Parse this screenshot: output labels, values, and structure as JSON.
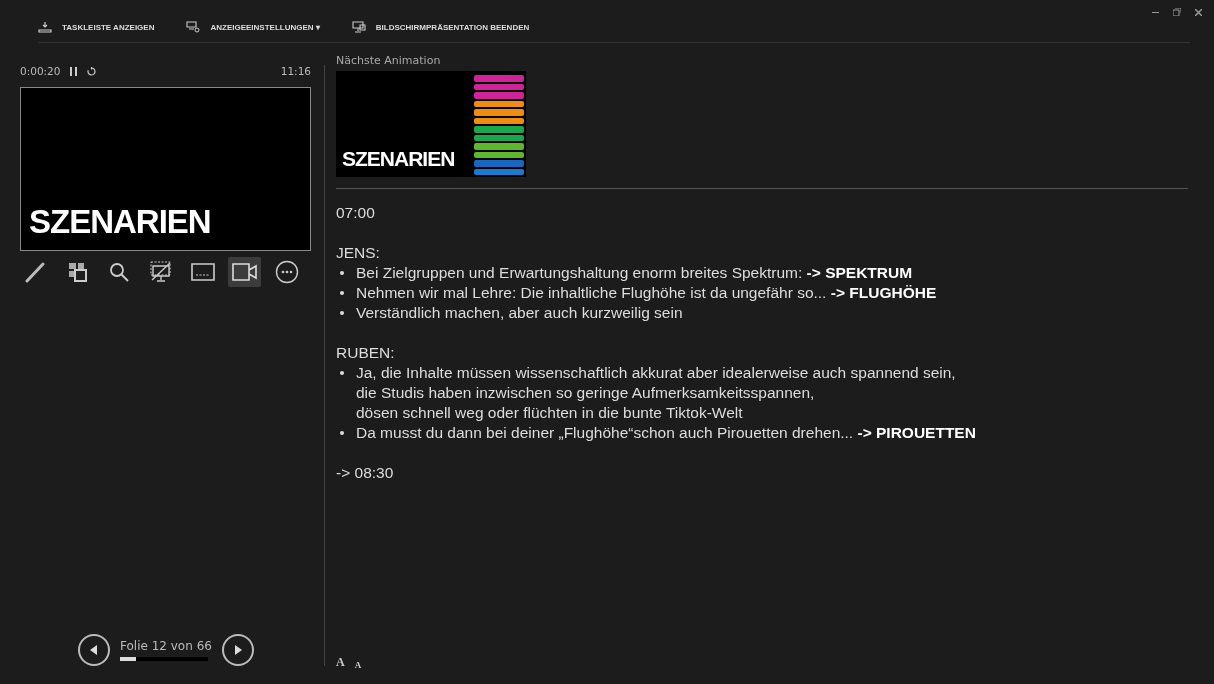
{
  "toolbar": [
    {
      "kind": "taskbar",
      "label": "TASKLEISTE ANZEIGEN"
    },
    {
      "kind": "display",
      "label": "ANZEIGEEINSTELLUNGEN ▾"
    },
    {
      "kind": "end",
      "label": "BILDSCHIRMPRÄSENTATION BEENDEN"
    }
  ],
  "timer": {
    "elapsed": "0:00:20",
    "paused": true,
    "clock": "11:16"
  },
  "current_slide": {
    "title": "SZENARIEN"
  },
  "tools": [
    {
      "kind": "pen",
      "selected": false
    },
    {
      "kind": "slides",
      "selected": false
    },
    {
      "kind": "zoom",
      "selected": false
    },
    {
      "kind": "black",
      "selected": false
    },
    {
      "kind": "subtitles",
      "selected": false
    },
    {
      "kind": "camera",
      "selected": true
    },
    {
      "kind": "more",
      "selected": false
    }
  ],
  "navigation": {
    "label": "Folie 12 von 66",
    "level": 0.18
  },
  "next": {
    "label": "Nächste Animation",
    "title": "SZENARIEN",
    "bars": [
      {
        "color": "#d0239a"
      },
      {
        "color": "#d0239a"
      },
      {
        "color": "#d0239a"
      },
      {
        "color": "#f08c10"
      },
      {
        "color": "#f08c10"
      },
      {
        "color": "#f08c10"
      },
      {
        "color": "#1aa84a"
      },
      {
        "color": "#1aa84a"
      },
      {
        "color": "#5cb82e"
      },
      {
        "color": "#5cb82e"
      },
      {
        "color": "#1766c0"
      },
      {
        "color": "#1a7ad0"
      }
    ]
  },
  "notes": [
    {
      "kind": "line",
      "text": "07:00"
    },
    {
      "kind": "gap"
    },
    {
      "kind": "line",
      "text": "JENS:"
    },
    {
      "kind": "bullet",
      "text": "Bei Zielgruppen und Erwartungshaltung enorm breites Spektrum: **-> SPEKTRUM**"
    },
    {
      "kind": "bullet",
      "text": "Nehmen wir mal Lehre: Die inhaltliche Flughöhe ist da ungefähr so... **-> FLUGHÖHE**"
    },
    {
      "kind": "bullet",
      "text": "Verständlich machen, aber auch kurzweilig sein"
    },
    {
      "kind": "gap"
    },
    {
      "kind": "line",
      "text": "RUBEN:"
    },
    {
      "kind": "bullet",
      "text": "Ja, die Inhalte müssen wissenschaftlich akkurat aber idealerweise auch spannend sein,"
    },
    {
      "kind": "cont",
      "text": "die Studis haben inzwischen so geringe Aufmerksamkeitsspannen,"
    },
    {
      "kind": "cont",
      "text": "dösen schnell weg oder flüchten in die bunte Tiktok-Welt"
    },
    {
      "kind": "bullet",
      "text": "Da musst du dann bei deiner „Flughöhe“schon auch Pirouetten drehen... **-> PIROUETTEN**"
    },
    {
      "kind": "gap"
    },
    {
      "kind": "line",
      "text": "-> 08:30"
    }
  ],
  "font_buttons": [
    {
      "kind": "larger",
      "label": "A"
    },
    {
      "kind": "smaller",
      "label": "A"
    }
  ]
}
